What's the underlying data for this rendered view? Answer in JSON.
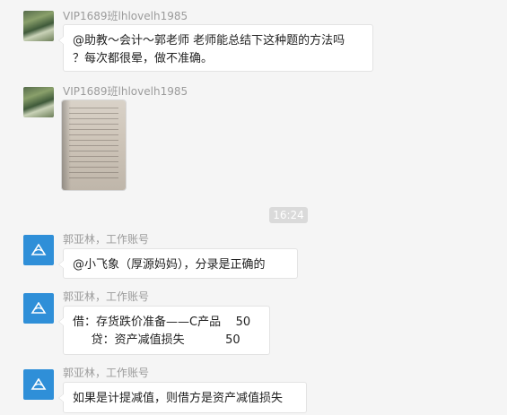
{
  "messages": [
    {
      "sender": "VIP1689班lhlovelh1985",
      "lines": [
        "@助教～会计～郭老师 老师能总结下这种题的方法吗",
        "？每次都很晕，做不准确。"
      ]
    },
    {
      "sender": "VIP1689班lhlovelh1985",
      "attachment": "photo-of-textbook-page"
    },
    {
      "sender": "郭亚林，工作账号",
      "lines": [
        "@小飞象（厚源妈妈），分录是正确的"
      ]
    },
    {
      "sender": "郭亚林，工作账号",
      "lines": [
        "借：存货跌价准备——C产品    50",
        "     贷：资产减值损失           50"
      ]
    },
    {
      "sender": "郭亚林，工作账号",
      "lines": [
        "如果是计提减值，则借方是资产减值损失"
      ]
    }
  ],
  "timestamp": "16:24",
  "icons": {
    "avatar_user": "user-photo-avatar",
    "avatar_teacher": "company-logo-avatar"
  },
  "colors": {
    "background": "#f5f5f5",
    "bubble": "#ffffff",
    "sender_text": "#9b9b9b",
    "timestamp_bg": "#dadada",
    "logo_blue": "#2f8fd8"
  }
}
